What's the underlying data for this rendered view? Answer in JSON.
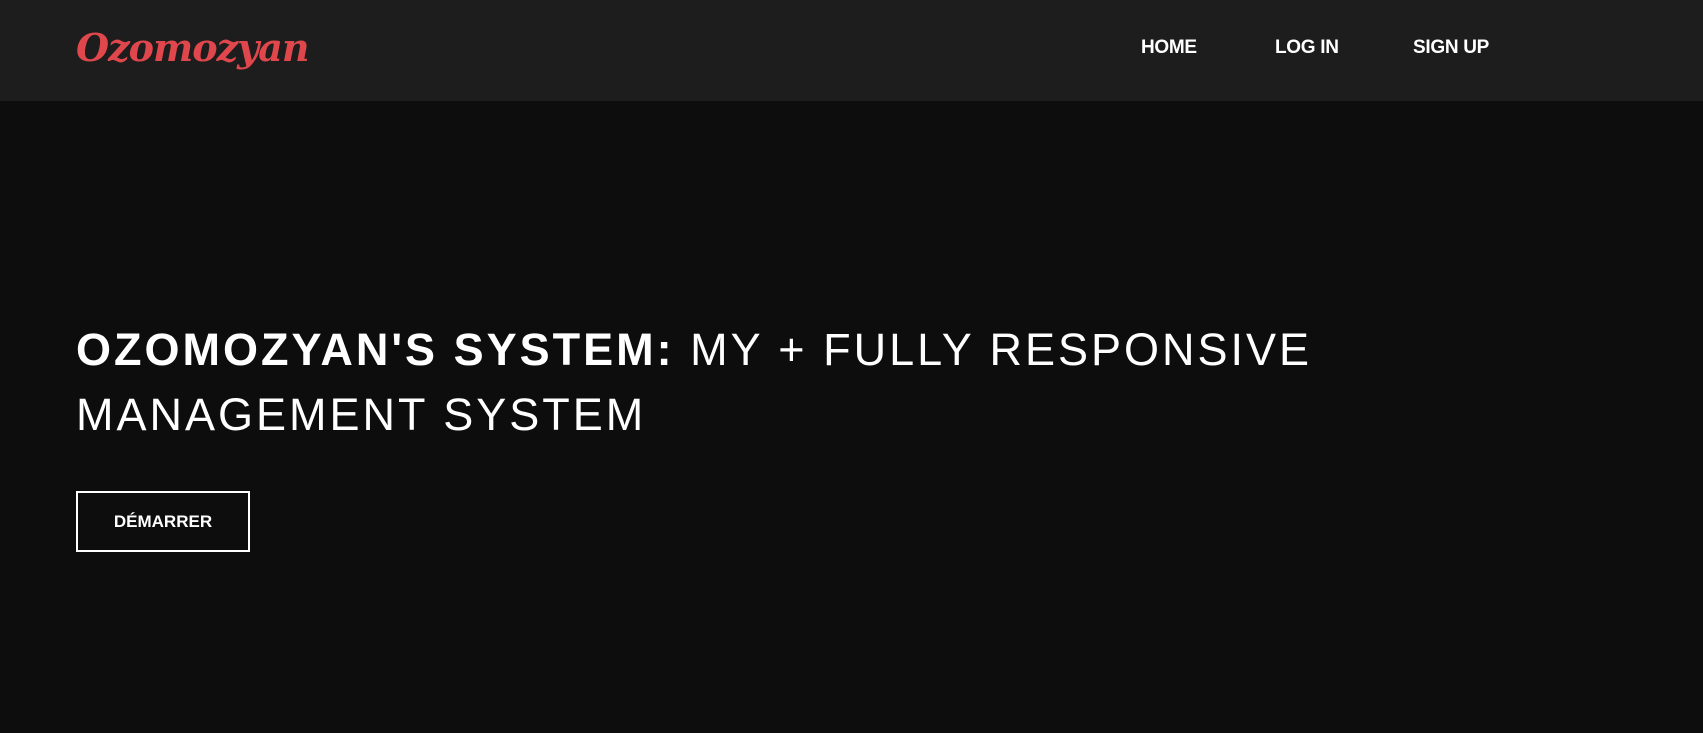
{
  "navbar": {
    "logo_text": "Ozomozyan",
    "links": [
      {
        "label": "HOME"
      },
      {
        "label": "LOG IN"
      },
      {
        "label": "SIGN UP"
      }
    ]
  },
  "hero": {
    "title_bold": "OZOMOZYAN'S SYSTEM:",
    "title_rest_line1": "MY + FULLY RESPONSIVE",
    "title_rest_line2": "MANAGEMENT SYSTEM",
    "cta_label": "DÉMARRER"
  },
  "colors": {
    "navbar_bg": "#1d1d1d",
    "page_bg": "#0d0d0d",
    "logo": "#e0474c",
    "text": "#ffffff"
  }
}
